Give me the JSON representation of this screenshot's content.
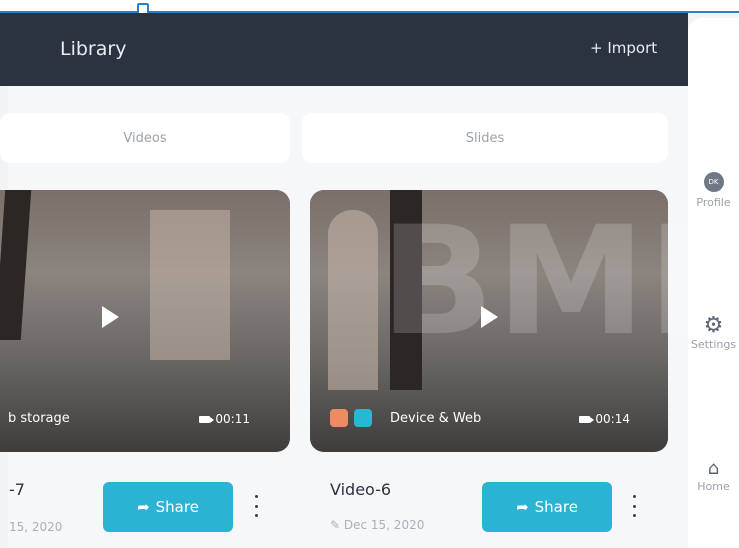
{
  "header": {
    "title": "Library",
    "import_label": "+ Import"
  },
  "tabs": [
    {
      "label": "Videos"
    },
    {
      "label": "Slides"
    }
  ],
  "videos": [
    {
      "storage_label": "b storage",
      "duration": "00:11",
      "title": "-7",
      "date": "15, 2020",
      "share_label": "Share"
    },
    {
      "storage_label": "Device & Web",
      "duration": "00:14",
      "title": "Video-6",
      "date": "Dec 15, 2020",
      "share_label": "Share"
    }
  ],
  "side_nav": [
    {
      "label": "Profile",
      "initials": "DK"
    },
    {
      "label": "Settings"
    },
    {
      "label": "Home"
    }
  ],
  "watermark": "BMK",
  "colors": {
    "header_bg": "#2b3240",
    "share_bg": "#2bb3d4",
    "accent_line": "#2f7fc0",
    "device_badge": "#f08a63",
    "web_badge": "#29b7d6"
  }
}
